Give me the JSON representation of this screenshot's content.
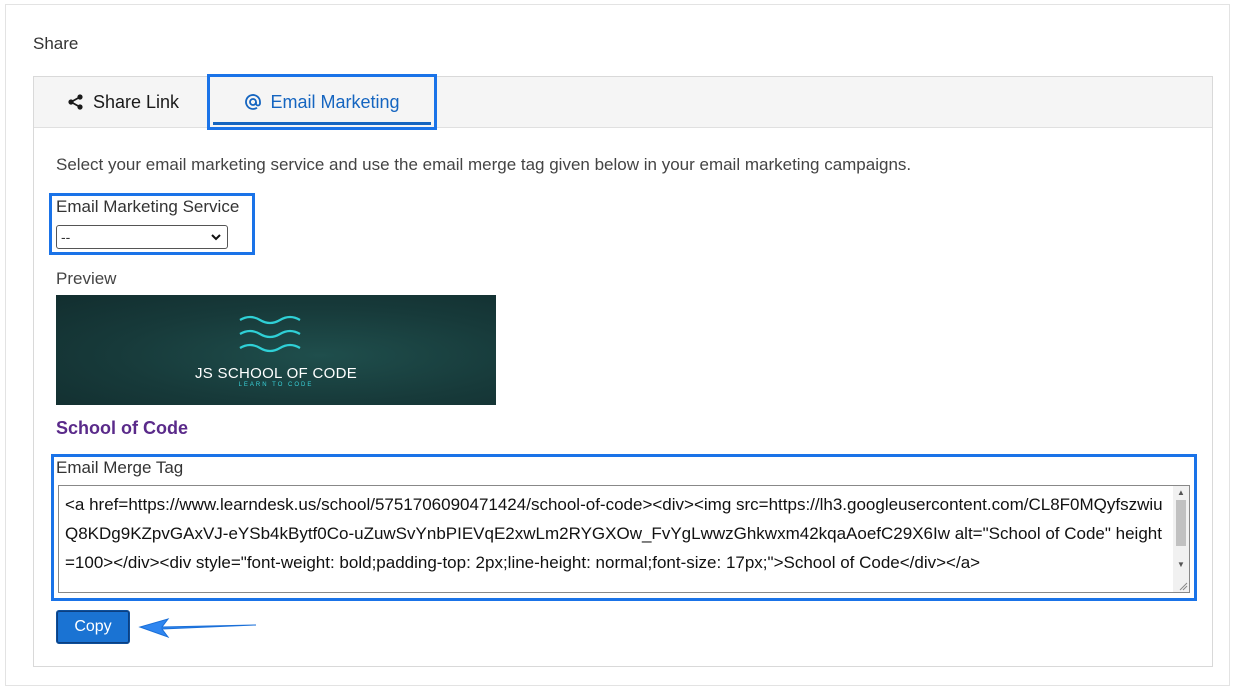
{
  "share_title": "Share",
  "tabs": [
    {
      "label": "Share Link",
      "icon": "share-icon"
    },
    {
      "label": "Email Marketing",
      "icon": "at-sign-icon"
    }
  ],
  "active_tab": "Email Marketing",
  "intro": "Select your email marketing service and use the email merge tag given below in your email marketing campaigns.",
  "service": {
    "label": "Email Marketing Service",
    "selected": "--"
  },
  "preview": {
    "label": "Preview",
    "logo_text": "JS SCHOOL OF CODE",
    "logo_subtext": "LEARN TO CODE"
  },
  "school_name": "School of Code",
  "merge_tag": {
    "label": "Email Merge Tag",
    "value": "<a href=https://www.learndesk.us/school/5751706090471424/school-of-code><div><img src=https://lh3.googleusercontent.com/CL8F0MQyfszwiuQ8KDg9KZpvGAxVJ-eYSb4kBytf0Co-uZuwSvYnbPIEVqE2xwLm2RYGXOw_FvYgLwwzGhkwxm42kqaAoefC29X6Iw alt=\"School of Code\" height=100></div><div style=\"font-weight: bold;padding-top: 2px;line-height: normal;font-size: 17px;\">School of Code</div></a>"
  },
  "copy_label": "Copy",
  "colors": {
    "accent": "#1a73e8",
    "tab_active_text": "#1565c0",
    "school_name": "#5a2a8a",
    "button": "#1a73d3"
  }
}
